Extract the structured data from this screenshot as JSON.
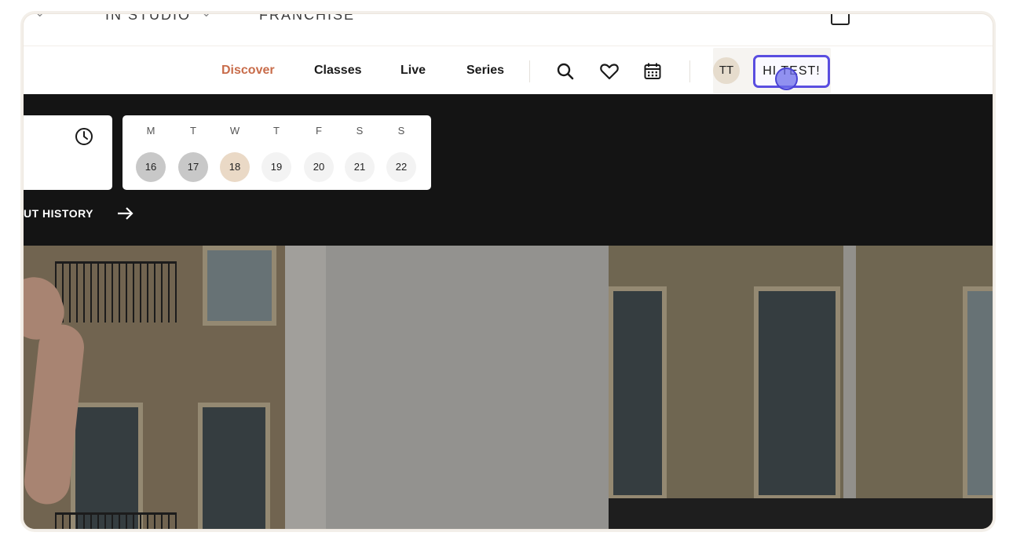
{
  "top_nav": {
    "crop_items": [
      "IN STUDIO",
      "FRANCHISE"
    ]
  },
  "nav": {
    "links": [
      {
        "label": "Discover",
        "active": true
      },
      {
        "label": "Classes",
        "active": false
      },
      {
        "label": "Live",
        "active": false
      },
      {
        "label": "Series",
        "active": false
      }
    ],
    "icons": [
      "search-icon",
      "heart-icon",
      "calendar-icon"
    ],
    "user": {
      "initials": "TT",
      "greeting": "HI TEST!"
    }
  },
  "schedule": {
    "day_letters": [
      "M",
      "T",
      "W",
      "T",
      "F",
      "S",
      "S"
    ],
    "day_numbers": [
      "16",
      "17",
      "18",
      "19",
      "20",
      "21",
      "22"
    ],
    "today": "18"
  },
  "history": {
    "label": "UT HISTORY"
  },
  "colors": {
    "accent": "#c86c4a",
    "highlight": "#5a4de0",
    "band": "#141414",
    "today_circle": "#ead9c6",
    "past_circle": "#c8c8c8"
  }
}
